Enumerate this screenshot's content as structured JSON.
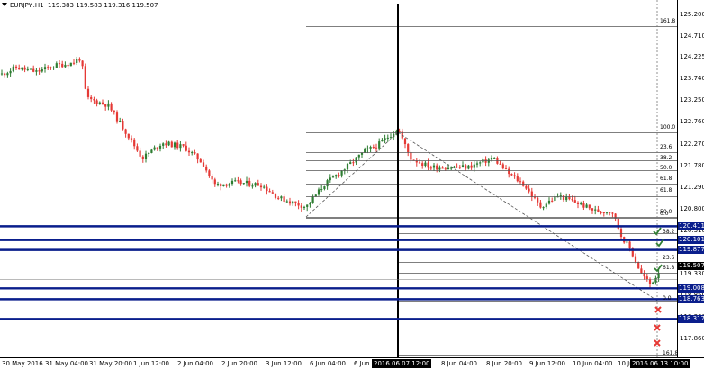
{
  "header": {
    "symbol": "EURJPY..H1",
    "ohlc": "119.383 119.583 119.316 119.507"
  },
  "price_axis": {
    "labels": [
      "125.200",
      "124.710",
      "124.225",
      "123.740",
      "123.250",
      "122.760",
      "122.270",
      "121.780",
      "121.290",
      "120.800",
      "120.310",
      "119.820",
      "119.330",
      "118.850",
      "118.360",
      "117.860"
    ],
    "marked": [
      {
        "value": "120.411",
        "color": "#0a1e8c"
      },
      {
        "value": "120.101",
        "color": "#0a1e8c"
      },
      {
        "value": "119.877",
        "color": "#0a1e8c"
      },
      {
        "value": "119.507",
        "color": "#000000"
      },
      {
        "value": "119.008",
        "color": "#0a1e8c"
      },
      {
        "value": "118.763",
        "color": "#0a1e8c"
      },
      {
        "value": "118.317",
        "color": "#0a1e8c"
      }
    ]
  },
  "time_axis": {
    "labels": [
      "30 May 2016",
      "31 May 04:00",
      "31 May 20:00",
      "1 Jun 12:00",
      "2 Jun 04:00",
      "2 Jun 20:00",
      "3 Jun 12:00",
      "6 Jun 04:00",
      "6 Jun",
      "8 Jun 04:00",
      "8 Jun 20:00",
      "9 Jun 12:00",
      "10 Jun 04:00",
      "10 Jun"
    ],
    "highlighted": [
      "2016.06.07 12:00",
      "2016.06.13 10:00"
    ]
  },
  "fib_upper": [
    "161.8",
    "100.0",
    "23.6",
    "38.2",
    "50.0",
    "61.8",
    "61.8",
    "50.0",
    "0.0"
  ],
  "fib_lower": [
    "38.2",
    "23.6",
    "61.8",
    "0.0",
    "161.8"
  ],
  "colors": {
    "bull": "#2e7d32",
    "bear": "#e53935",
    "support": "#0a1e8c",
    "cross": "#e53935",
    "check": "#2e7d32"
  },
  "icons": [
    "check-icon",
    "cross-icon",
    "menu-arrow-icon"
  ]
}
